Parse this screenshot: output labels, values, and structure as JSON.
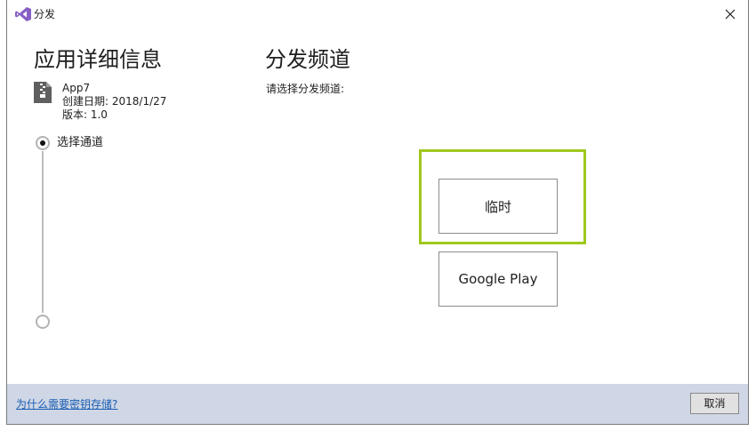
{
  "window": {
    "title": "分发",
    "close_glyph": "✕"
  },
  "icons": {
    "app": "visual-studio-icon",
    "package": "zip-file-icon",
    "close": "close-icon"
  },
  "left": {
    "heading": "应用详细信息",
    "app_name": "App7",
    "created": "创建日期: 2018/1/27",
    "version": "版本: 1.0",
    "steps": [
      {
        "label": "选择通道",
        "active": true
      },
      {
        "label": "",
        "active": false
      }
    ]
  },
  "right": {
    "heading": "分发频道",
    "subtitle": "请选择分发频道:",
    "channels": [
      {
        "label": "临时",
        "focused": true
      },
      {
        "label": "Google Play",
        "focused": false
      }
    ]
  },
  "footer": {
    "link": "为什么需要密钥存储?",
    "cancel": "取消"
  },
  "colors": {
    "focus_ring": "#a0c81e",
    "footer_bg": "#cfd6e5",
    "link": "#1a5fb4",
    "vs_purple": "#865fc5"
  }
}
